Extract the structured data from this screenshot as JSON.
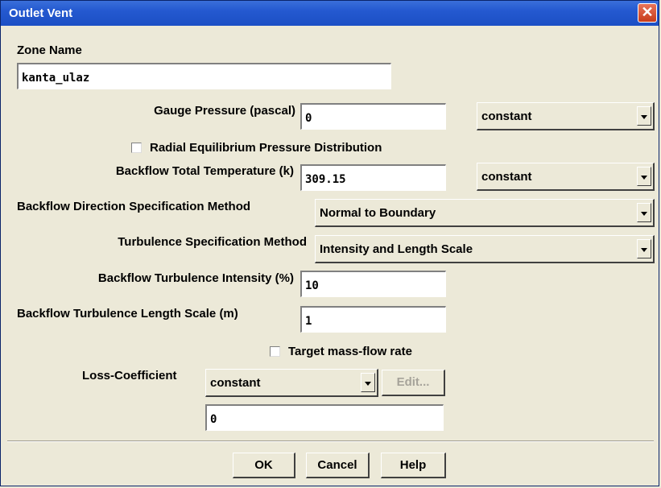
{
  "window": {
    "title": "Outlet Vent",
    "close_glyph": "✕"
  },
  "zone": {
    "label": "Zone Name",
    "value": "kanta_ulaz"
  },
  "gauge_pressure": {
    "label": "Gauge Pressure (pascal)",
    "value": "0",
    "method": "constant"
  },
  "radial_equilibrium": {
    "label": "Radial Equilibrium Pressure Distribution",
    "checked": false
  },
  "backflow_temperature": {
    "label": "Backflow Total Temperature (k)",
    "value": "309.15",
    "method": "constant"
  },
  "backflow_direction": {
    "label": "Backflow Direction Specification Method",
    "value": "Normal to Boundary"
  },
  "turbulence_method": {
    "label": "Turbulence Specification Method",
    "value": "Intensity and Length Scale"
  },
  "turbulence_intensity": {
    "label": "Backflow Turbulence Intensity (%)",
    "value": "10"
  },
  "turbulence_length": {
    "label": "Backflow Turbulence Length Scale (m)",
    "value": "1"
  },
  "target_mass_flow": {
    "label": "Target mass-flow rate",
    "checked": false
  },
  "loss_coefficient": {
    "label": "Loss-Coefficient",
    "method": "constant",
    "edit_label": "Edit...",
    "value": "0"
  },
  "buttons": {
    "ok": "OK",
    "cancel": "Cancel",
    "help": "Help"
  },
  "icons": {
    "close": "close-icon",
    "dropdown": "chevron-down-icon"
  },
  "colors": {
    "titlebar": "#2459D0",
    "background": "#ECE9D8",
    "close_button": "#D9532F"
  }
}
